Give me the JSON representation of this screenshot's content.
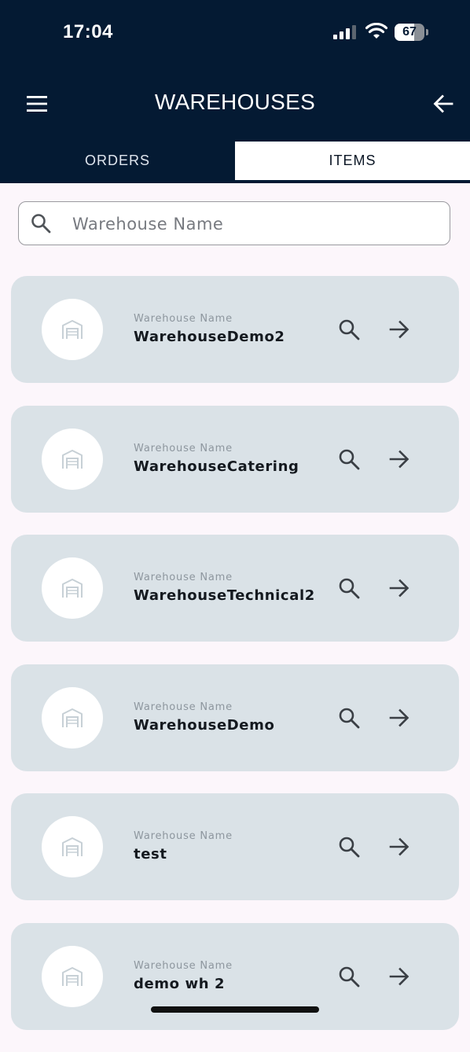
{
  "status": {
    "time": "17:04",
    "battery": "67",
    "battery_level": 0.67
  },
  "app_bar": {
    "title": "WAREHOUSES"
  },
  "tabs": [
    {
      "label": "ORDERS",
      "selected": false
    },
    {
      "label": "ITEMS",
      "selected": true
    }
  ],
  "search": {
    "placeholder": "Warehouse Name",
    "value": ""
  },
  "warehouses": [
    {
      "label": "Warehouse Name",
      "name": "WarehouseDemo2"
    },
    {
      "label": "Warehouse Name",
      "name": "WarehouseCatering"
    },
    {
      "label": "Warehouse Name",
      "name": "WarehouseTechnical2"
    },
    {
      "label": "Warehouse Name",
      "name": "WarehouseDemo"
    },
    {
      "label": "Warehouse Name",
      "name": "test"
    },
    {
      "label": "Warehouse Name",
      "name": "demo wh 2"
    }
  ],
  "icons": {
    "menu": "menu-icon",
    "back": "arrow-left-icon",
    "search": "search-icon",
    "warehouse": "warehouse-icon",
    "open": "arrow-right-icon"
  },
  "colors": {
    "header_bg": "#041A33",
    "page_bg": "#FCF6FB",
    "card_bg": "#DAE2E7",
    "text_dark": "#14191F"
  }
}
